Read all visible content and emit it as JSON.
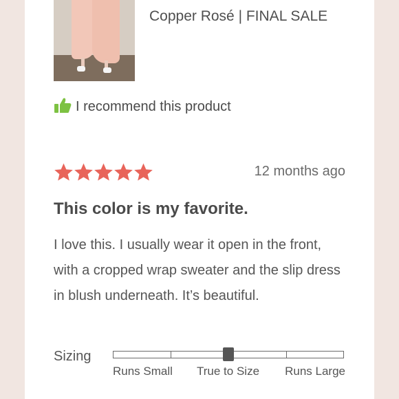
{
  "product": {
    "title_line": "Copper Rosé | FINAL SALE",
    "recommend_text": "I recommend this product"
  },
  "review": {
    "rating": 5,
    "max_rating": 5,
    "date": "12 months ago",
    "title": "This color is my favorite.",
    "body": "I love this. I usually wear it open in the front, with a cropped wrap sweater and the slip dress in blush underneath. It’s beautiful."
  },
  "sizing": {
    "label": "Sizing",
    "scale_labels": [
      "Runs Small",
      "True to Size",
      "Runs Large"
    ],
    "value_fraction": 0.5
  },
  "colors": {
    "star": "#e8645a",
    "thumb_icon": "#7dc242",
    "background": "#f1e6e1"
  },
  "icons": {
    "recommend": "thumbs-up-icon",
    "star": "star-icon"
  }
}
